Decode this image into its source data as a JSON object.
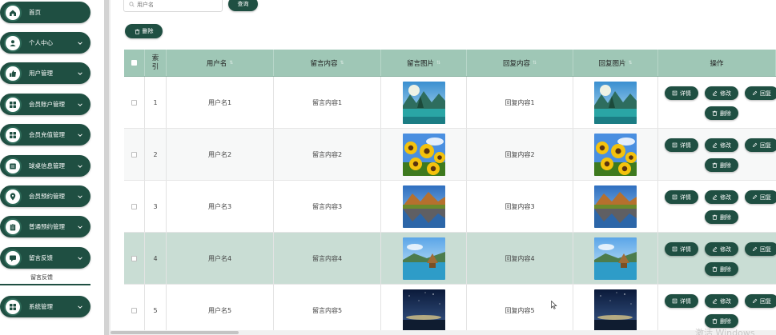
{
  "sidebar": {
    "items": [
      {
        "label": "首页",
        "icon": "home-icon",
        "has_chevron": false
      },
      {
        "label": "个人中心",
        "icon": "user-icon",
        "has_chevron": true
      },
      {
        "label": "用户管理",
        "icon": "thumb-icon",
        "has_chevron": true
      },
      {
        "label": "会员账户管理",
        "icon": "grid-icon",
        "has_chevron": true
      },
      {
        "label": "会员充值管理",
        "icon": "grid-icon",
        "has_chevron": true
      },
      {
        "label": "球桌信息管理",
        "icon": "list-icon",
        "has_chevron": true
      },
      {
        "label": "会员预约管理",
        "icon": "pin-icon",
        "has_chevron": true
      },
      {
        "label": "普通预约管理",
        "icon": "clipboard-icon",
        "has_chevron": true
      },
      {
        "label": "留言反馈",
        "icon": "chat-icon",
        "has_chevron": true
      },
      {
        "label": "系统管理",
        "icon": "grid-icon",
        "has_chevron": true
      }
    ],
    "sub_item": "留言反馈"
  },
  "search": {
    "placeholder": "用户名",
    "query_label": "查询"
  },
  "toolbar": {
    "delete_label": "删除"
  },
  "table": {
    "headers": {
      "index": "索引",
      "username": "用户名",
      "message": "留言内容",
      "message_image": "留言图片",
      "reply": "回复内容",
      "reply_image": "回复图片",
      "actions": "操作"
    },
    "actions": {
      "detail": "详情",
      "edit": "修改",
      "reply": "回复",
      "delete": "删除"
    },
    "rows": [
      {
        "index": "1",
        "username": "用户名1",
        "message": "留言内容1",
        "reply": "回复内容1",
        "image": "lake-mountains",
        "highlight": false
      },
      {
        "index": "2",
        "username": "用户名2",
        "message": "留言内容2",
        "reply": "回复内容2",
        "image": "sunflowers",
        "highlight": false
      },
      {
        "index": "3",
        "username": "用户名3",
        "message": "留言内容3",
        "reply": "回复内容3",
        "image": "autumn-lake",
        "highlight": false
      },
      {
        "index": "4",
        "username": "用户名4",
        "message": "留言内容4",
        "reply": "回复内容4",
        "image": "lake-hut",
        "highlight": true
      },
      {
        "index": "5",
        "username": "用户名5",
        "message": "留言内容5",
        "reply": "回复内容5",
        "image": "night-sky",
        "highlight": false
      }
    ]
  },
  "colors": {
    "brand": "#1f4f42",
    "header_bg": "#9fc7b6",
    "row_highlight": "#c9ddd4",
    "row_alt": "#f7f8f8"
  },
  "watermark": "激活 Windows"
}
